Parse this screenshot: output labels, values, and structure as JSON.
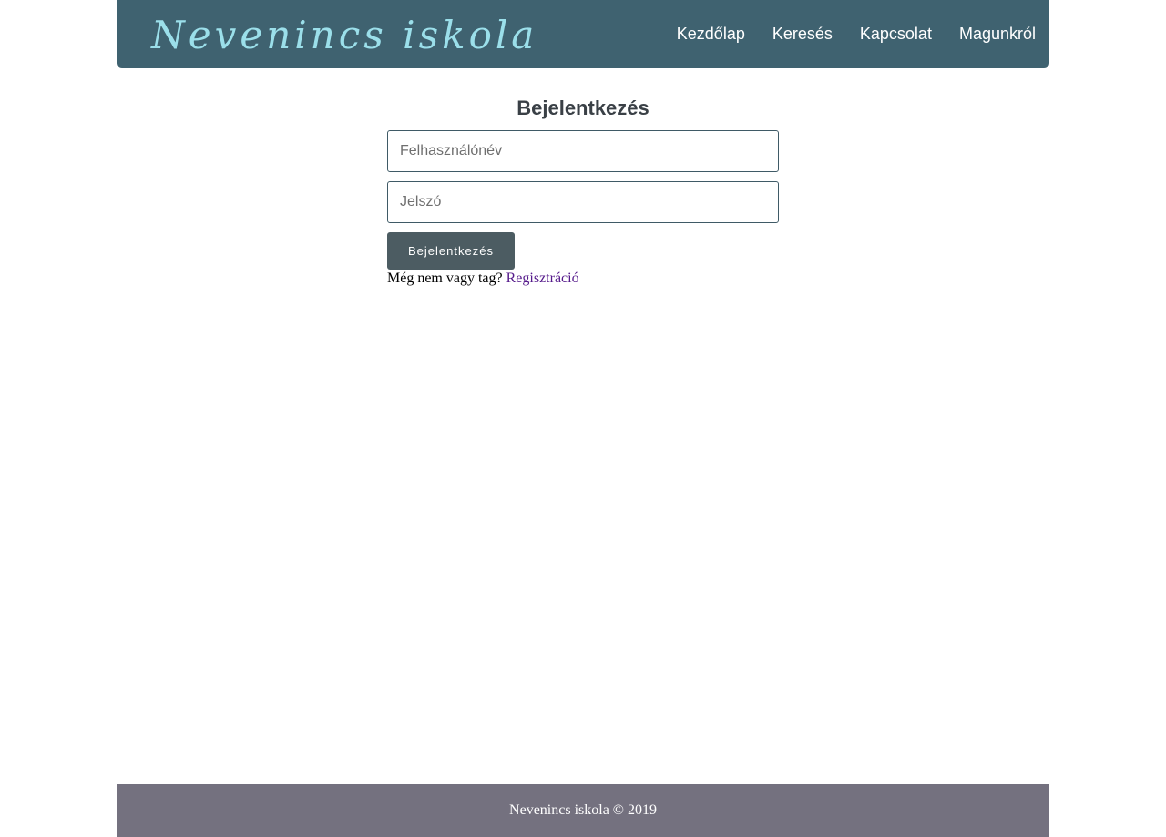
{
  "header": {
    "logo": "Nevenincs iskola",
    "nav": [
      {
        "label": "Kezdőlap"
      },
      {
        "label": "Keresés"
      },
      {
        "label": "Kapcsolat"
      },
      {
        "label": "Magunkról"
      }
    ]
  },
  "login": {
    "title": "Bejelentkezés",
    "username_placeholder": "Felhasználónév",
    "username_value": "",
    "password_placeholder": "Jelszó",
    "password_value": "",
    "submit_label": "Bejelentkezés",
    "signup_prompt": "Még nem vagy tag?",
    "signup_link": "Regisztráció"
  },
  "footer": {
    "text": "Nevenincs iskola © 2019"
  },
  "colors": {
    "header_bg": "#3f6270",
    "logo": "#9bdfea",
    "button_bg": "#4c5c62",
    "footer_bg": "#74717f",
    "link": "#551a8b"
  }
}
